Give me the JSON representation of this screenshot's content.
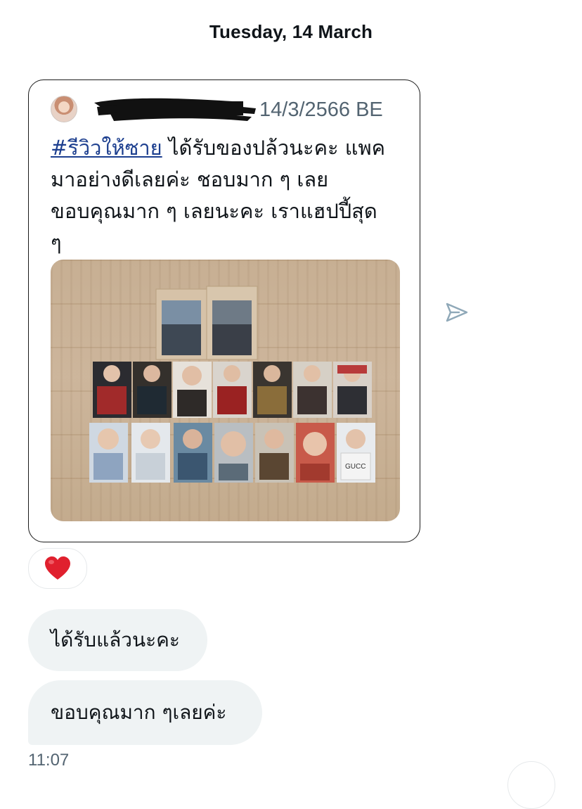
{
  "date_header": "Tuesday, 14 March",
  "tweet": {
    "date": "14/3/2566 BE",
    "hashtag": "#รีวิวให้ซาย",
    "text_lines": [
      " ได้รับของปล้วนะคะ แพค",
      "มาอย่างดีเลยค่ะ ชอบมาก ๆ เลย",
      "ขอบคุณมาก ๆ เลยนะคะ เราแฮปปี้สุด",
      "ๆ"
    ],
    "photo_card_text": "GUCC"
  },
  "reaction": {
    "emoji": "❤️"
  },
  "messages": [
    {
      "text": "ได้รับแล้วนะคะ"
    },
    {
      "text": "ขอบคุณมาก ๆเลยค่ะ"
    }
  ],
  "message_time": "11:07",
  "icons": {
    "share": "share-arrow-icon",
    "reaction": "heart-icon"
  },
  "colors": {
    "hashtag": "#1d3f8f",
    "bubble_bg": "#eff3f4",
    "muted_text": "#536471",
    "share_icon": "#8fa8b8"
  }
}
